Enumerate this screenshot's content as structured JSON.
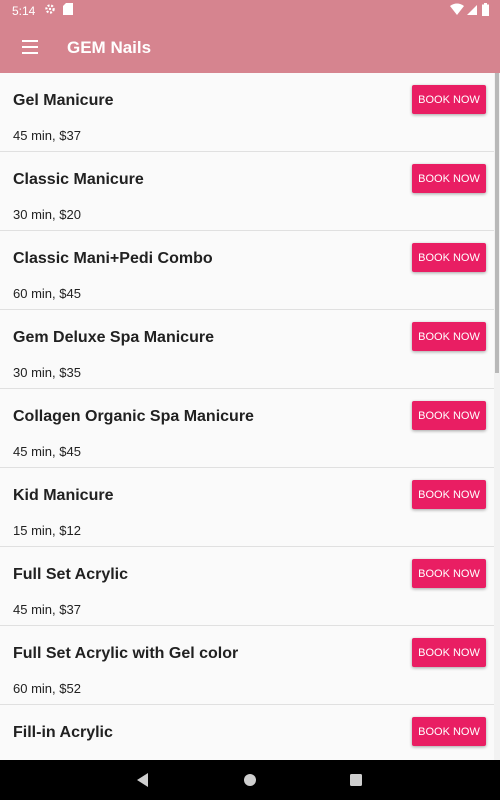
{
  "status_bar": {
    "time": "5:14"
  },
  "app_bar": {
    "title": "GEM Nails",
    "menu_icon": "menu-icon"
  },
  "colors": {
    "app_bar": "#d6848f",
    "accent": "#e91e63",
    "background": "#fafafa"
  },
  "services": [
    {
      "name": "Gel Manicure",
      "info": "45 min, $37",
      "button": "BOOK NOW"
    },
    {
      "name": "Classic Manicure",
      "info": "30 min, $20",
      "button": "BOOK NOW"
    },
    {
      "name": "Classic Mani+Pedi Combo",
      "info": "60 min, $45",
      "button": "BOOK NOW"
    },
    {
      "name": "Gem Deluxe Spa Manicure",
      "info": "30 min, $35",
      "button": "BOOK NOW"
    },
    {
      "name": "Collagen Organic Spa Manicure",
      "info": "45 min, $45",
      "button": "BOOK NOW"
    },
    {
      "name": "Kid Manicure",
      "info": "15 min, $12",
      "button": "BOOK NOW"
    },
    {
      "name": "Full Set Acrylic",
      "info": "45 min, $37",
      "button": "BOOK NOW"
    },
    {
      "name": "Full Set Acrylic with Gel color",
      "info": "60 min, $52",
      "button": "BOOK NOW"
    },
    {
      "name": "Fill-in Acrylic",
      "info": "",
      "button": "BOOK NOW"
    }
  ],
  "nav": {
    "back": "back-icon",
    "home": "home-icon",
    "recents": "recents-icon"
  }
}
